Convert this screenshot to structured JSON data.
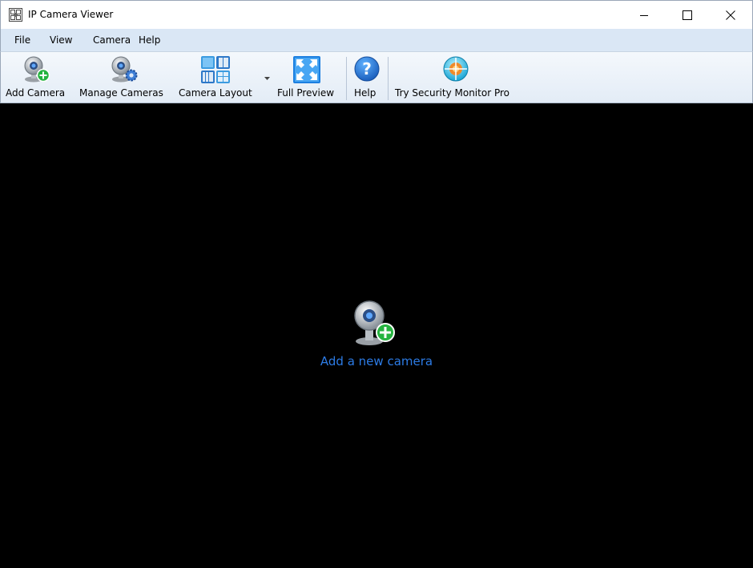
{
  "window": {
    "title": "IP Camera Viewer",
    "controls": {
      "minimize": "minimize-icon",
      "maximize": "maximize-icon",
      "close": "close-icon"
    }
  },
  "menu": {
    "items": [
      "File",
      "View",
      "Camera",
      "Help"
    ]
  },
  "toolbar": {
    "buttons": [
      {
        "label": "Add Camera",
        "icon": "add-camera-icon"
      },
      {
        "label": "Manage Cameras",
        "icon": "manage-cameras-icon"
      },
      {
        "label": "Camera Layout",
        "icon": "camera-layout-icon"
      },
      {
        "label": "Full Preview",
        "icon": "full-preview-icon"
      },
      {
        "label": "Help",
        "icon": "help-icon"
      },
      {
        "label": "Try Security Monitor Pro",
        "icon": "security-monitor-pro-icon"
      }
    ]
  },
  "viewport": {
    "cta": "Add a new camera",
    "background": "#000000",
    "cta_color": "#2c7be5"
  }
}
